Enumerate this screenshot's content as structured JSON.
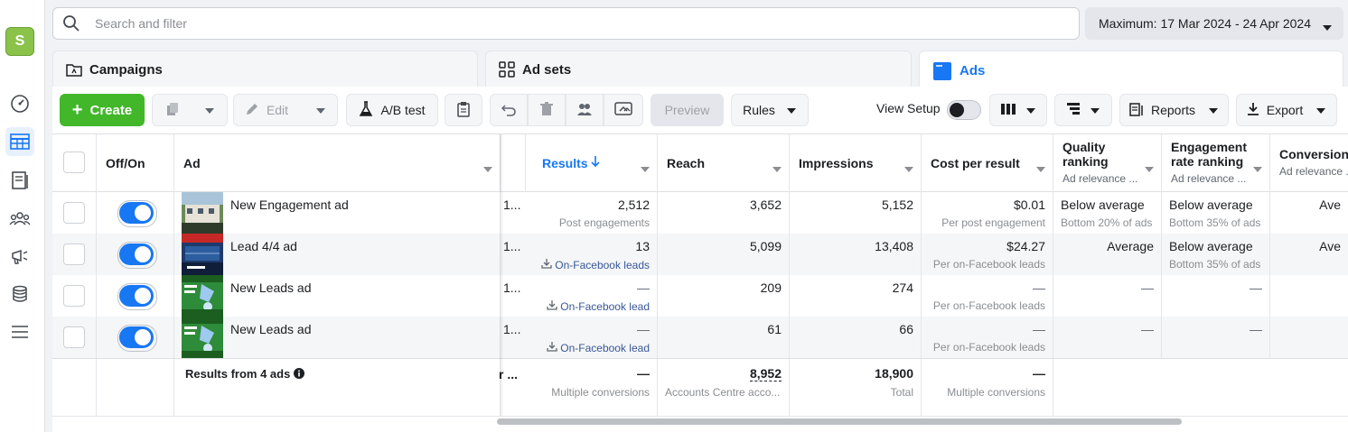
{
  "rail": {
    "logo_letter": "S",
    "items": [
      "gauge-icon",
      "table-icon",
      "catalog-icon",
      "audiences-icon",
      "megaphone-icon",
      "database-icon",
      "menu-icon"
    ]
  },
  "search": {
    "placeholder": "Search and filter"
  },
  "date_range": "Maximum: 17 Mar 2024 - 24 Apr 2024",
  "tabs": [
    {
      "label": "Campaigns",
      "active": false
    },
    {
      "label": "Ad sets",
      "active": false
    },
    {
      "label": "Ads",
      "active": true
    }
  ],
  "toolbar": {
    "create": "Create",
    "edit": "Edit",
    "ab_test": "A/B test",
    "preview": "Preview",
    "rules": "Rules",
    "view_setup": "View Setup",
    "reports": "Reports",
    "export": "Export"
  },
  "columns": {
    "off_on": "Off/On",
    "ad": "Ad",
    "results": "Results",
    "reach": "Reach",
    "impressions": "Impressions",
    "cost_per_result": "Cost per result",
    "quality_ranking": "Quality ranking",
    "quality_sub": "Ad relevance ...",
    "engagement_ranking": "Engagement rate ranking",
    "engagement_sub": "Ad relevance ...",
    "conversion_ranking": "Conversion rate ranking",
    "conversion_sub": "Ad relevance ..."
  },
  "rows": [
    {
      "name": "New Engagement ad",
      "ellipsis": "1...",
      "results": "2,512",
      "results_sub": "Post engagements",
      "reach": "3,652",
      "impressions": "5,152",
      "cpr": "$0.01",
      "cpr_sub": "Per post engagement",
      "quality": "Below average",
      "quality_sub": "Bottom 20% of ads",
      "engagement": "Below average",
      "engagement_sub": "Bottom 35% of ads",
      "conversion": "Ave"
    },
    {
      "name": "Lead 4/4 ad",
      "ellipsis": "1...",
      "results": "13",
      "results_sub": "On-Facebook leads",
      "reach": "5,099",
      "impressions": "13,408",
      "cpr": "$24.27",
      "cpr_sub": "Per on-Facebook leads",
      "quality": "Average",
      "quality_sub": "",
      "engagement": "Below average",
      "engagement_sub": "Bottom 35% of ads",
      "conversion": "Ave"
    },
    {
      "name": "New Leads ad",
      "ellipsis": "1...",
      "results": "—",
      "results_sub": "On-Facebook lead",
      "reach": "209",
      "impressions": "274",
      "cpr": "—",
      "cpr_sub": "Per on-Facebook leads",
      "quality": "—",
      "quality_sub": "",
      "engagement": "—",
      "engagement_sub": "",
      "conversion": ""
    },
    {
      "name": "New Leads ad",
      "ellipsis": "1...",
      "results": "—",
      "results_sub": "On-Facebook lead",
      "reach": "61",
      "impressions": "66",
      "cpr": "—",
      "cpr_sub": "Per on-Facebook leads",
      "quality": "—",
      "quality_sub": "",
      "engagement": "—",
      "engagement_sub": "",
      "conversion": ""
    }
  ],
  "totals": {
    "label": "Results from 4 ads",
    "ellipsis": "r ...",
    "results": "—",
    "results_sub": "Multiple conversions",
    "reach": "8,952",
    "reach_sub": "Accounts Centre acco...",
    "impressions": "18,900",
    "impressions_sub": "Total",
    "cpr": "—",
    "cpr_sub": "Multiple conversions"
  },
  "colors": {
    "accent": "#1877f2",
    "create": "#42b72a",
    "link": "#385898"
  }
}
